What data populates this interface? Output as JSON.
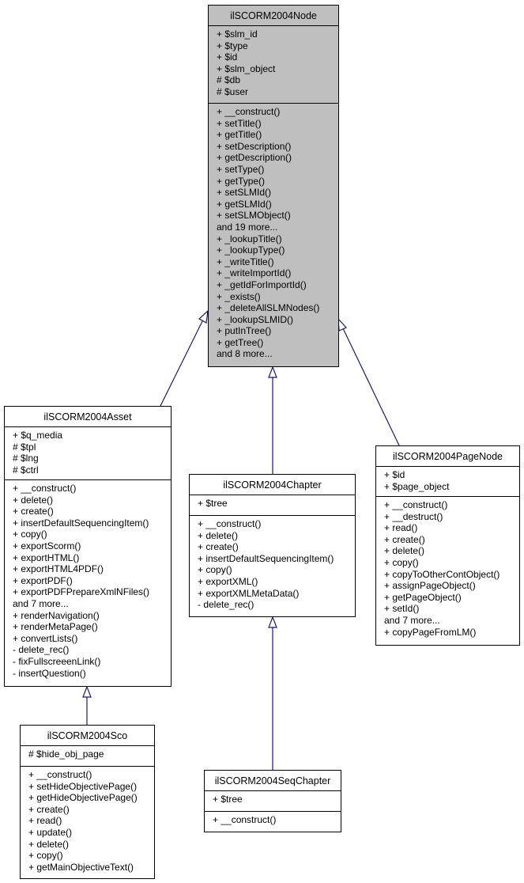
{
  "diagram": {
    "type": "class-inheritance",
    "edge_color": "#191970",
    "focus_fill": "#bfbfbf",
    "classes": {
      "node": {
        "name": "ilSCORM2004Node",
        "attributes": [
          "+ $slm_id",
          "+ $type",
          "+ $id",
          "+ $slm_object",
          "# $db",
          "# $user"
        ],
        "methods": [
          "+ __construct()",
          "+ setTitle()",
          "+ getTitle()",
          "+ setDescription()",
          "+ getDescription()",
          "+ setType()",
          "+ getType()",
          "+ setSLMId()",
          "+ getSLMId()",
          "+ setSLMObject()",
          "and 19 more...",
          "+ _lookupTitle()",
          "+ _lookupType()",
          "+ _writeTitle()",
          "+ _writeImportId()",
          "+ _getIdForImportId()",
          "+ _exists()",
          "+ _deleteAllSLMNodes()",
          "+ _lookupSLMID()",
          "+ putInTree()",
          "+ getTree()",
          "and 8 more..."
        ]
      },
      "asset": {
        "name": "ilSCORM2004Asset",
        "attributes": [
          "+ $q_media",
          "# $tpl",
          "# $lng",
          "# $ctrl"
        ],
        "methods": [
          "+ __construct()",
          "+ delete()",
          "+ create()",
          "+ insertDefaultSequencingItem()",
          "+ copy()",
          "+ exportScorm()",
          "+ exportHTML()",
          "+ exportHTML4PDF()",
          "+ exportPDF()",
          "+ exportPDFPrepareXmlNFiles()",
          "and 7 more...",
          "+ renderNavigation()",
          "+ renderMetaPage()",
          "+ convertLists()",
          "- delete_rec()",
          "- fixFullscreeenLink()",
          "- insertQuestion()"
        ]
      },
      "chapter": {
        "name": "ilSCORM2004Chapter",
        "attributes": [
          "+ $tree"
        ],
        "methods": [
          "+ __construct()",
          "+ delete()",
          "+ create()",
          "+ insertDefaultSequencingItem()",
          "+ copy()",
          "+ exportXML()",
          "+ exportXMLMetaData()",
          "- delete_rec()"
        ]
      },
      "pagenode": {
        "name": "ilSCORM2004PageNode",
        "attributes": [
          "+ $id",
          "+ $page_object"
        ],
        "methods": [
          "+ __construct()",
          "+ __destruct()",
          "+ read()",
          "+ create()",
          "+ delete()",
          "+ copy()",
          "+ copyToOtherContObject()",
          "+ assignPageObject()",
          "+ getPageObject()",
          "+ setId()",
          "and 7 more...",
          "+ copyPageFromLM()"
        ]
      },
      "sco": {
        "name": "ilSCORM2004Sco",
        "attributes": [
          "# $hide_obj_page"
        ],
        "methods": [
          "+ __construct()",
          "+ setHideObjectivePage()",
          "+ getHideObjectivePage()",
          "+ create()",
          "+ read()",
          "+ update()",
          "+ delete()",
          "+ copy()",
          "+ getMainObjectiveText()"
        ]
      },
      "seqchapter": {
        "name": "ilSCORM2004SeqChapter",
        "attributes": [
          "+ $tree"
        ],
        "methods": [
          "+ __construct()"
        ]
      }
    },
    "inheritance": [
      {
        "child": "ilSCORM2004Asset",
        "parent": "ilSCORM2004Node"
      },
      {
        "child": "ilSCORM2004Chapter",
        "parent": "ilSCORM2004Node"
      },
      {
        "child": "ilSCORM2004PageNode",
        "parent": "ilSCORM2004Node"
      },
      {
        "child": "ilSCORM2004Sco",
        "parent": "ilSCORM2004Asset"
      },
      {
        "child": "ilSCORM2004SeqChapter",
        "parent": "ilSCORM2004Chapter"
      }
    ]
  }
}
